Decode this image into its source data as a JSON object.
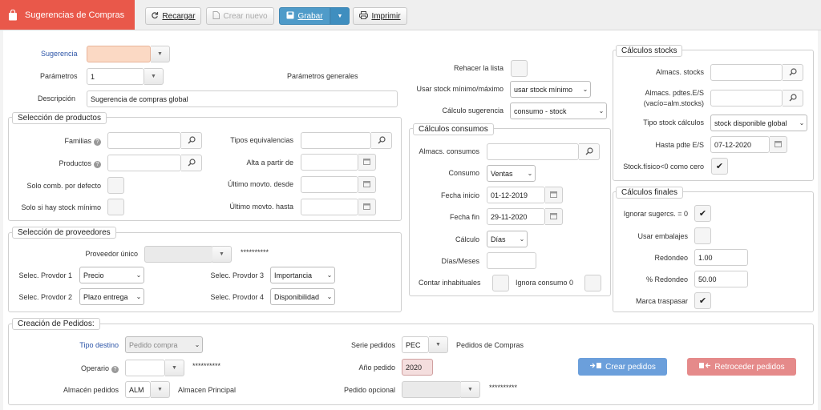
{
  "app": {
    "title": "Sugerencias de Compras"
  },
  "toolbar": {
    "reload": "Recargar",
    "new": "Crear nuevo",
    "save": "Grabar",
    "print": "Imprimir"
  },
  "header": {
    "sugerencia_label": "Sugerencia",
    "parametros_label": "Parámetros",
    "parametros_value": "1",
    "parametros_desc": "Parámetros generales",
    "descripcion_label": "Descripción",
    "descripcion_value": "Sugerencia de compras global",
    "rehacer_label": "Rehacer la lista",
    "usar_stock_label": "Usar stock mínimo/máximo",
    "usar_stock_value": "usar stock mínimo",
    "calculo_sug_label": "Cálculo sugerencia",
    "calculo_sug_value": "consumo - stock"
  },
  "productos": {
    "title": "Selección de productos",
    "familias": "Familias",
    "productos": "Productos",
    "solo_comb": "Solo comb. por defecto",
    "solo_stock": "Solo si hay stock mínimo",
    "tipos_equiv": "Tipos equivalencias",
    "alta": "Alta a partir de",
    "ult_desde": "Último movto. desde",
    "ult_hasta": "Último movto. hasta"
  },
  "proveedores": {
    "title": "Selección de proveedores",
    "unico_label": "Proveedor único",
    "unico_mask": "**********",
    "p1_label": "Selec. Provdor 1",
    "p1_value": "Precio",
    "p2_label": "Selec. Provdor 2",
    "p2_value": "Plazo entrega",
    "p3_label": "Selec. Provdor 3",
    "p3_value": "Importancia",
    "p4_label": "Selec. Provdor 4",
    "p4_value": "Disponibilidad"
  },
  "consumos": {
    "title": "Cálculos consumos",
    "almacs": "Almacs. consumos",
    "consumo_label": "Consumo",
    "consumo_value": "Ventas",
    "inicio_label": "Fecha inicio",
    "inicio_value": "01-12-2019",
    "fin_label": "Fecha fin",
    "fin_value": "29-11-2020",
    "calculo_label": "Cálculo",
    "calculo_value": "Días",
    "dias_label": "Días/Meses",
    "contar_label": "Contar inhabituales",
    "ignora_label": "Ignora consumo 0"
  },
  "stocks": {
    "title": "Cálculos stocks",
    "almacs": "Almacs. stocks",
    "pdtes_1": "Almacs. pdtes.E/S",
    "pdtes_2": "(vacío=alm.stocks)",
    "tipo_label": "Tipo stock cálculos",
    "tipo_value": "stock disponible global",
    "hasta_label": "Hasta pdte E/S",
    "hasta_value": "07-12-2020",
    "fisico_label": "Stock.físico<0 como cero",
    "fisico_check": "✔"
  },
  "finales": {
    "title": "Cálculos finales",
    "ignorar_label": "Ignorar sugercs. = 0",
    "ignorar_check": "✔",
    "embalajes_label": "Usar embalajes",
    "redondeo_label": "Redondeo",
    "redondeo_value": "1.00",
    "pct_label": "% Redondeo",
    "pct_value": "50.00",
    "marca_label": "Marca traspasar",
    "marca_check": "✔"
  },
  "pedidos": {
    "title": "Creación de Pedidos:",
    "tipo_label": "Tipo destino",
    "tipo_value": "Pedido compra",
    "operario_label": "Operario",
    "operario_mask": "**********",
    "almacen_label": "Almacén pedidos",
    "almacen_value": "ALM",
    "almacen_desc": "Almacen Principal",
    "serie_label": "Serie pedidos",
    "serie_value": "PEC",
    "serie_desc": "Pedidos de Compras",
    "anio_label": "Año pedido",
    "anio_value": "2020",
    "opcional_label": "Pedido opcional",
    "opcional_mask": "**********",
    "crear_btn": "Crear pedidos",
    "retroceder_btn": "Retroceder pedidos"
  },
  "colors": {
    "brand": "#e9584a",
    "primary": "#4f9bc9",
    "action_blue": "#6b9fdb",
    "action_red": "#e58a8a"
  },
  "icons": [
    "shopping-bag-icon",
    "refresh-icon",
    "new-doc-icon",
    "save-icon",
    "print-icon",
    "search-icon",
    "calendar-icon",
    "help-icon",
    "check-icon",
    "caret-down-icon"
  ]
}
